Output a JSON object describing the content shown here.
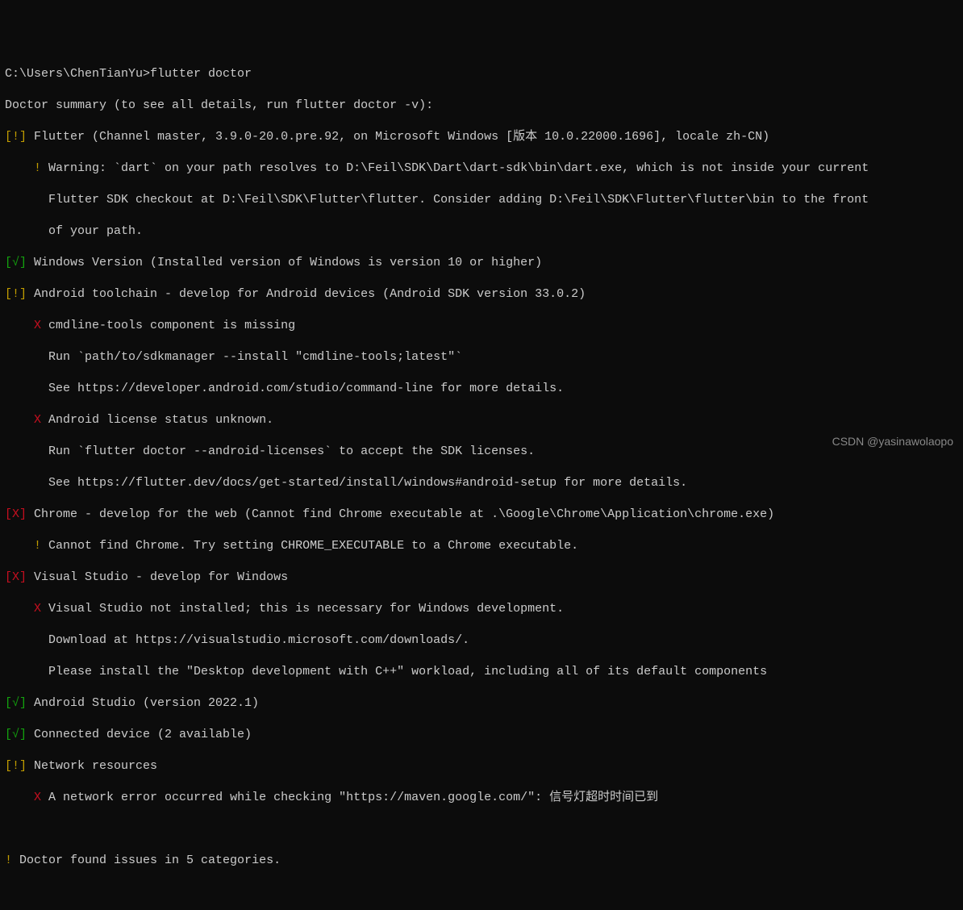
{
  "prompt": "C:\\Users\\ChenTianYu>",
  "command": "flutter doctor",
  "summary": "Doctor summary (to see all details, run flutter doctor -v):",
  "flutter": {
    "status": "[!]",
    "text": " Flutter (Channel master, 3.9.0-20.0.pre.92, on Microsoft Windows [版本 10.0.22000.1696], locale zh-CN)",
    "warn_prefix": "    ! ",
    "warn_text": "Warning: `dart` on your path resolves to D:\\Feil\\SDK\\Dart\\dart-sdk\\bin\\dart.exe, which is not inside your current",
    "warn_cont1": "      Flutter SDK checkout at D:\\Feil\\SDK\\Flutter\\flutter. Consider adding D:\\Feil\\SDK\\Flutter\\flutter\\bin to the front",
    "warn_cont2": "      of your path."
  },
  "windows": {
    "status": "[√]",
    "text": " Windows Version (Installed version of Windows is version 10 or higher)"
  },
  "android_toolchain": {
    "status": "[!]",
    "text": " Android toolchain - develop for Android devices (Android SDK version 33.0.2)",
    "x1_prefix": "    X ",
    "x1_text": "cmdline-tools component is missing",
    "x1_line2": "      Run `path/to/sdkmanager --install \"cmdline-tools;latest\"`",
    "x1_line3": "      See https://developer.android.com/studio/command-line for more details.",
    "x2_prefix": "    X ",
    "x2_text": "Android license status unknown.",
    "x2_line2": "      Run `flutter doctor --android-licenses` to accept the SDK licenses.",
    "x2_line3": "      See https://flutter.dev/docs/get-started/install/windows#android-setup for more details."
  },
  "chrome": {
    "status": "[X]",
    "text": " Chrome - develop for the web (Cannot find Chrome executable at .\\Google\\Chrome\\Application\\chrome.exe)",
    "warn_prefix": "    ! ",
    "warn_text": "Cannot find Chrome. Try setting CHROME_EXECUTABLE to a Chrome executable."
  },
  "visual_studio": {
    "status": "[X]",
    "text": " Visual Studio - develop for Windows",
    "x_prefix": "    X ",
    "x_text": "Visual Studio not installed; this is necessary for Windows development.",
    "line2": "      Download at https://visualstudio.microsoft.com/downloads/.",
    "line3": "      Please install the \"Desktop development with C++\" workload, including all of its default components"
  },
  "android_studio": {
    "status": "[√]",
    "text": " Android Studio (version 2022.1)"
  },
  "connected": {
    "status": "[√]",
    "text": " Connected device (2 available)"
  },
  "network": {
    "status": "[!]",
    "text": " Network resources",
    "x_prefix": "    X ",
    "x_text": "A network error occurred while checking \"https://maven.google.com/\": 信号灯超时时间已到"
  },
  "footer_prefix": "! ",
  "footer_text": "Doctor found issues in 5 categories.",
  "watermark": "CSDN @yasinawolaopo"
}
